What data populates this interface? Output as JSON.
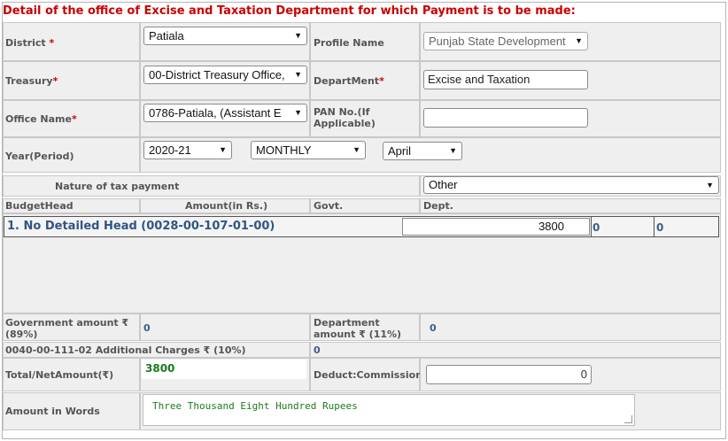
{
  "title": "Detail of the office of Excise and Taxation Department for which Payment is to be made:",
  "fields": {
    "district": {
      "label": "District",
      "required_mark": "*",
      "value": "Patiala"
    },
    "profile_name": {
      "label": "Profile Name",
      "value": "Punjab State Development"
    },
    "treasury": {
      "label": "Treasury",
      "required_mark": "*",
      "value": "00-District Treasury Office,"
    },
    "department": {
      "label": "DepartMent",
      "required_mark": "*",
      "value": "Excise and Taxation"
    },
    "office_name": {
      "label": "Office Name",
      "required_mark": "*",
      "value": "0786-Patiala, (Assistant E"
    },
    "pan": {
      "label_line1": "PAN No.(If",
      "label_line2": "Applicable)",
      "value": ""
    },
    "year": {
      "label": "Year(Period)",
      "year_value": "2020-21",
      "period_value": "MONTHLY",
      "month_value": "April"
    },
    "nature": {
      "label": "Nature of tax payment",
      "value": "Other"
    }
  },
  "budget": {
    "headers": {
      "budget_head": "BudgetHead",
      "amount": "Amount(in Rs.)",
      "govt": "Govt.",
      "dept": "Dept."
    },
    "rows": [
      {
        "label": "1. No Detailed Head (0028-00-107-01-00)",
        "amount": "3800",
        "govt": "0",
        "dept": "0"
      }
    ]
  },
  "summary": {
    "govt_amount_label_line1": "Government amount ₹",
    "govt_amount_label_line2": "(89%)",
    "govt_amount_value": "0",
    "dept_amount_label_line1": "Department",
    "dept_amount_label_line2": "amount ₹ (11%)",
    "dept_amount_value": "0",
    "additional_label": "0040-00-111-02 Additional Charges ₹ (10%)",
    "additional_value": "0",
    "total_label": "Total/NetAmount(₹)",
    "total_value": "3800",
    "deduct_label": "Deduct:Commission",
    "deduct_value": "0",
    "words_label": "Amount in Words",
    "words_value": "Three Thousand Eight Hundred  Rupees"
  },
  "colors": {
    "title": "#cc0000",
    "required": "#d10000",
    "value_blue": "#3b5f8a",
    "total_green": "#1d7a1d"
  }
}
